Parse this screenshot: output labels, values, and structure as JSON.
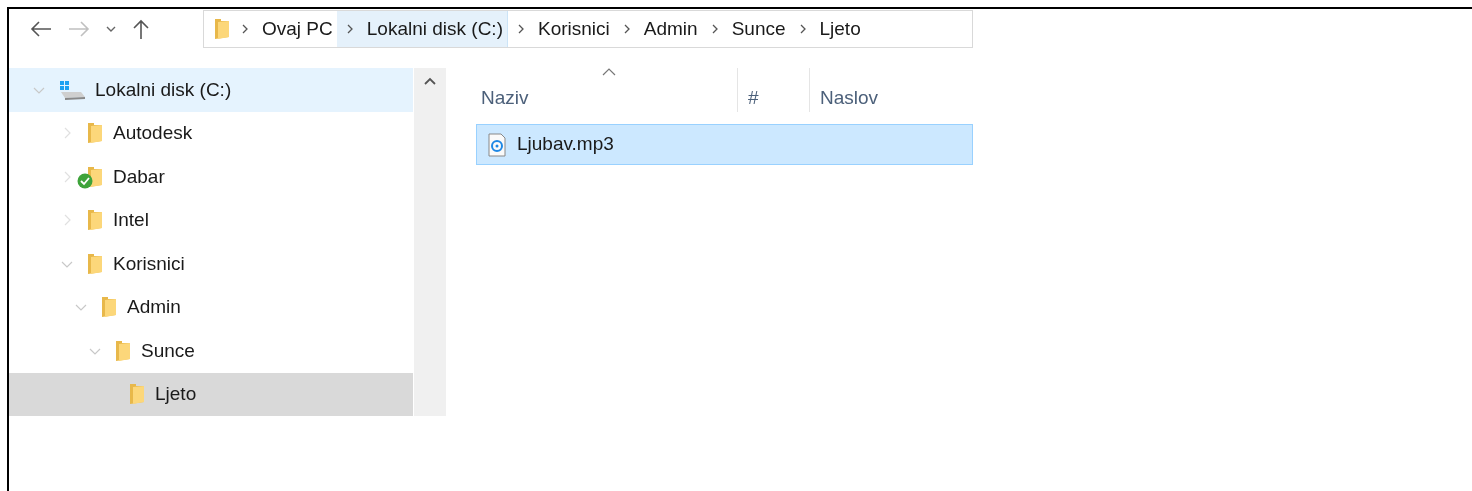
{
  "nav": {
    "back_disabled": false,
    "forward_disabled": true
  },
  "address": [
    {
      "label": "Ovaj PC",
      "highlighted": false
    },
    {
      "label": "Lokalni disk (C:)",
      "highlighted": true
    },
    {
      "label": "Korisnici",
      "highlighted": false
    },
    {
      "label": "Admin",
      "highlighted": false
    },
    {
      "label": "Sunce",
      "highlighted": false
    },
    {
      "label": "Ljeto",
      "highlighted": false
    }
  ],
  "tree": [
    {
      "label": "Lokalni disk (C:)",
      "kind": "drive",
      "expanded": true,
      "selected": false,
      "highlighted": true,
      "synced": false,
      "children": [
        {
          "label": "Autodesk",
          "kind": "folder",
          "expanded": false,
          "selected": false,
          "highlighted": false,
          "synced": false
        },
        {
          "label": "Dabar",
          "kind": "folder",
          "expanded": false,
          "selected": false,
          "highlighted": false,
          "synced": true
        },
        {
          "label": "Intel",
          "kind": "folder",
          "expanded": false,
          "selected": false,
          "highlighted": false,
          "synced": false
        },
        {
          "label": "Korisnici",
          "kind": "folder",
          "expanded": true,
          "selected": false,
          "highlighted": false,
          "synced": false,
          "children": [
            {
              "label": "Admin",
              "kind": "folder",
              "expanded": true,
              "selected": false,
              "highlighted": false,
              "synced": false,
              "children": [
                {
                  "label": "Sunce",
                  "kind": "folder",
                  "expanded": true,
                  "selected": false,
                  "highlighted": false,
                  "synced": false,
                  "children": [
                    {
                      "label": "Ljeto",
                      "kind": "folder",
                      "selected": true,
                      "highlighted": false,
                      "synced": false
                    }
                  ]
                }
              ]
            }
          ]
        }
      ]
    }
  ],
  "columns": [
    {
      "label": "Naziv",
      "sorted": true
    },
    {
      "label": "#",
      "sorted": false
    },
    {
      "label": "Naslov",
      "sorted": false
    }
  ],
  "files": [
    {
      "name": "Ljubav.mp3",
      "selected": true
    }
  ]
}
